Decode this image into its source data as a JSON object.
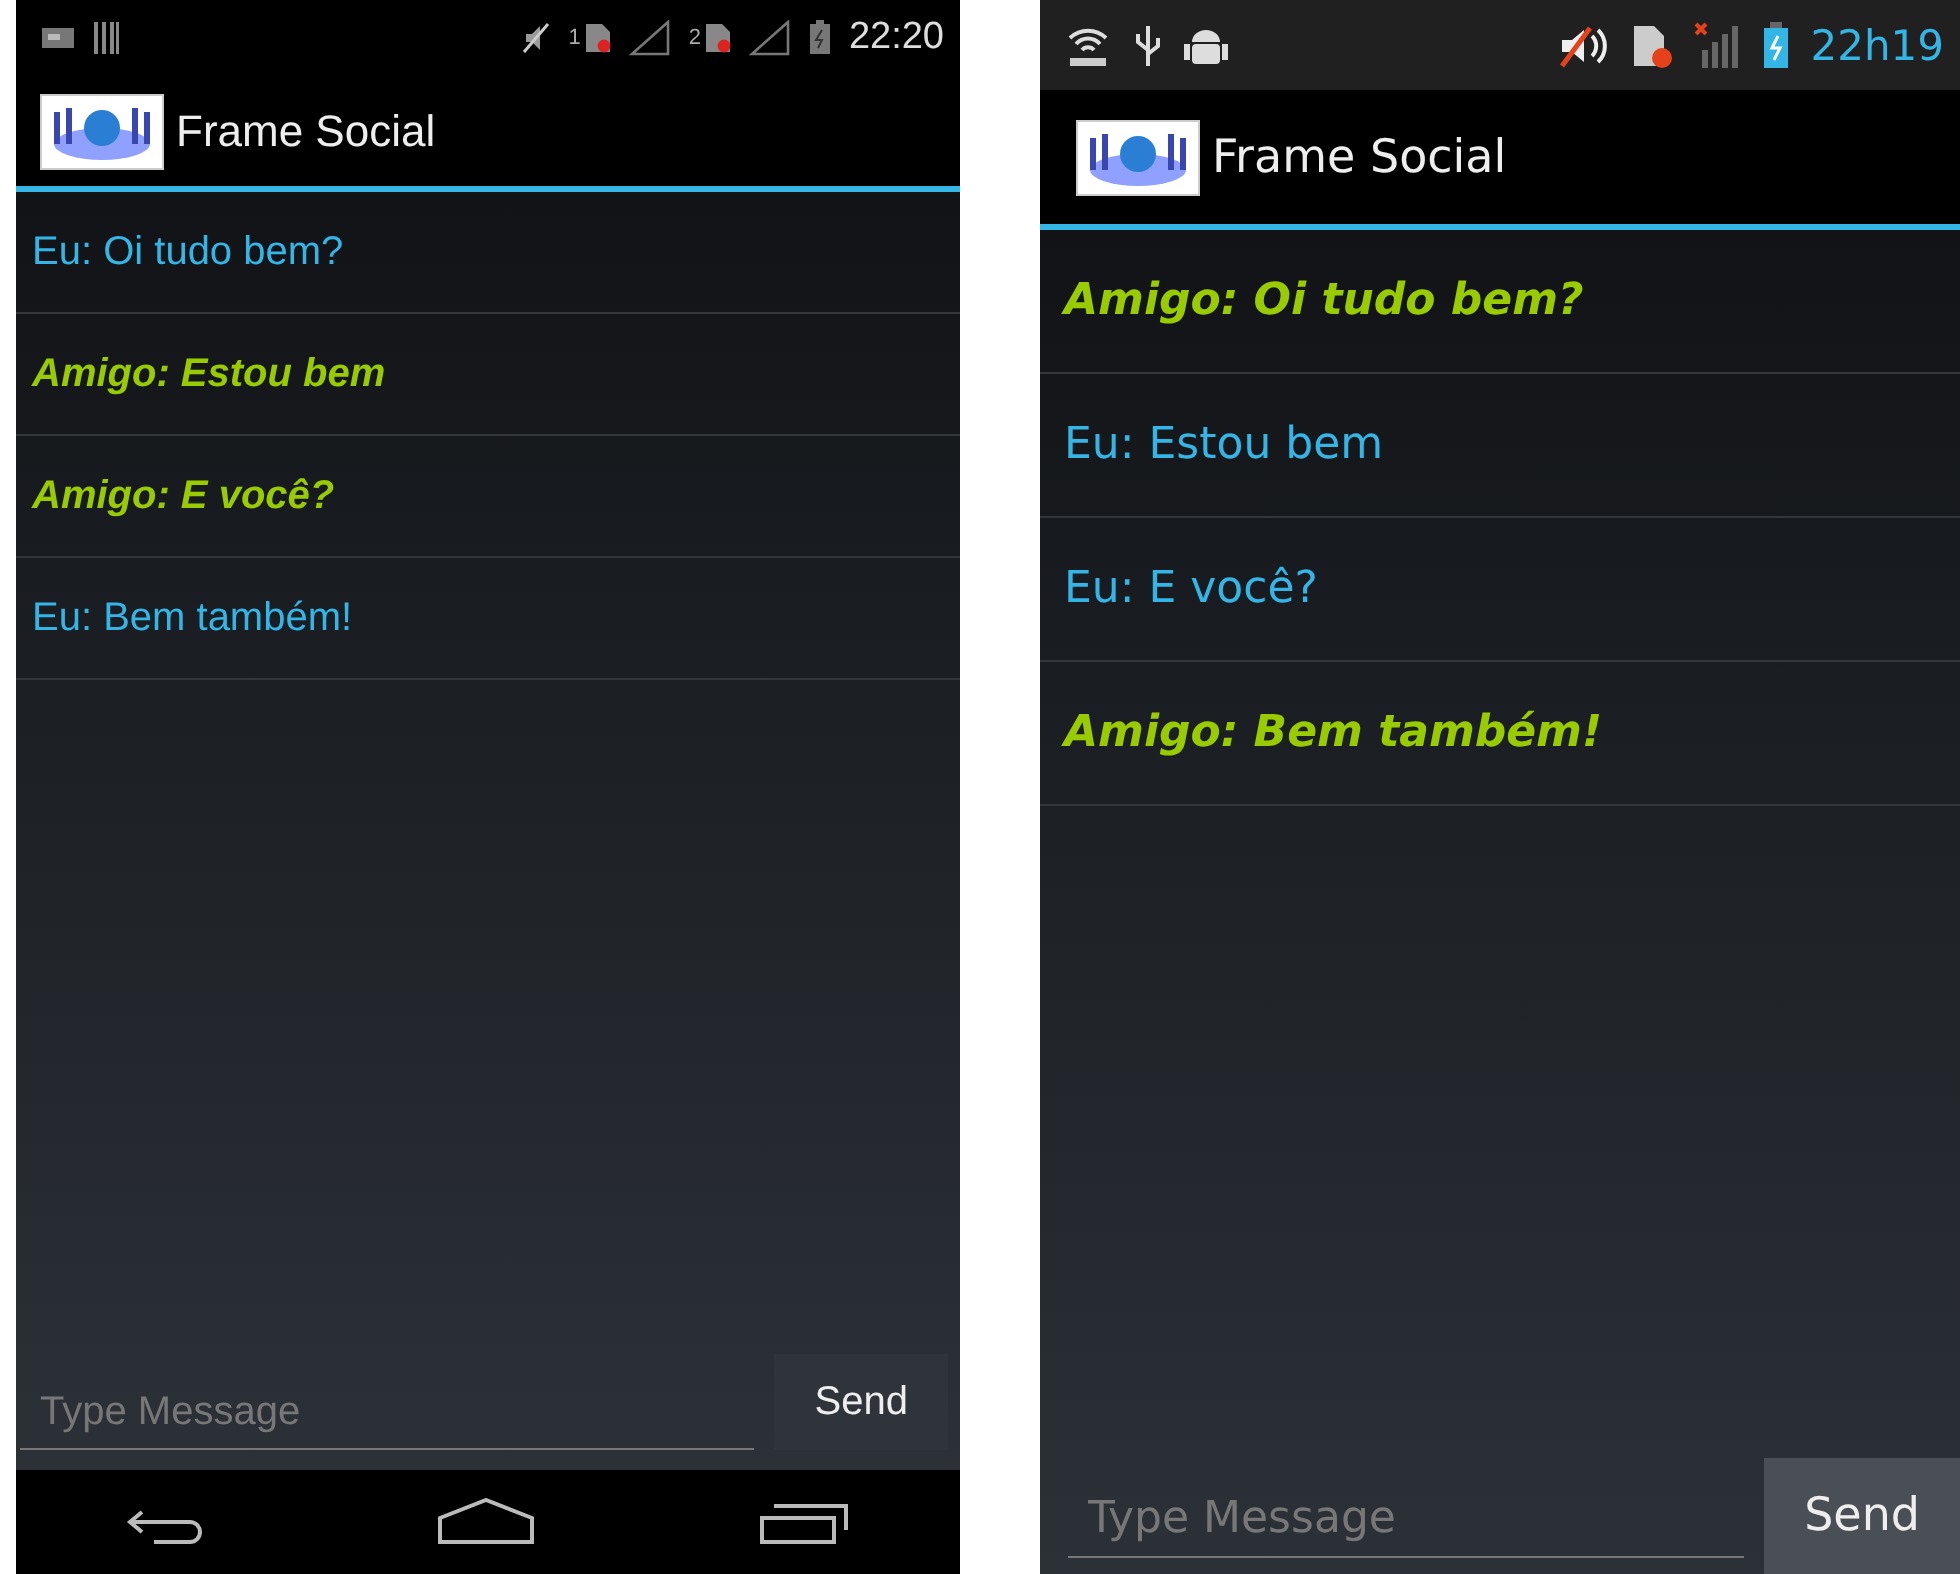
{
  "phones": [
    {
      "kind": "stock",
      "status_bar": {
        "time": "22:20",
        "sim_labels": [
          "1",
          "2"
        ]
      },
      "app_title": "Frame Social",
      "messages": [
        {
          "kind": "me",
          "text": "Eu: Oi tudo bem?"
        },
        {
          "kind": "friend",
          "text": "Amigo: Estou bem"
        },
        {
          "kind": "friend",
          "text": "Amigo: E você?"
        },
        {
          "kind": "me",
          "text": "Eu: Bem também!"
        }
      ],
      "message_input": {
        "placeholder": "Type Message"
      },
      "send_button": "Send",
      "nav_bar": true
    },
    {
      "kind": "samsung",
      "status_bar": {
        "time": "22h19"
      },
      "app_title": "Frame Social",
      "messages": [
        {
          "kind": "friend",
          "text": "Amigo: Oi tudo bem?"
        },
        {
          "kind": "me",
          "text": "Eu: Estou bem"
        },
        {
          "kind": "me",
          "text": "Eu: E você?"
        },
        {
          "kind": "friend",
          "text": "Amigo: Bem também!"
        }
      ],
      "message_input": {
        "placeholder": "Type Message"
      },
      "send_button": "Send",
      "nav_bar": false
    }
  ]
}
